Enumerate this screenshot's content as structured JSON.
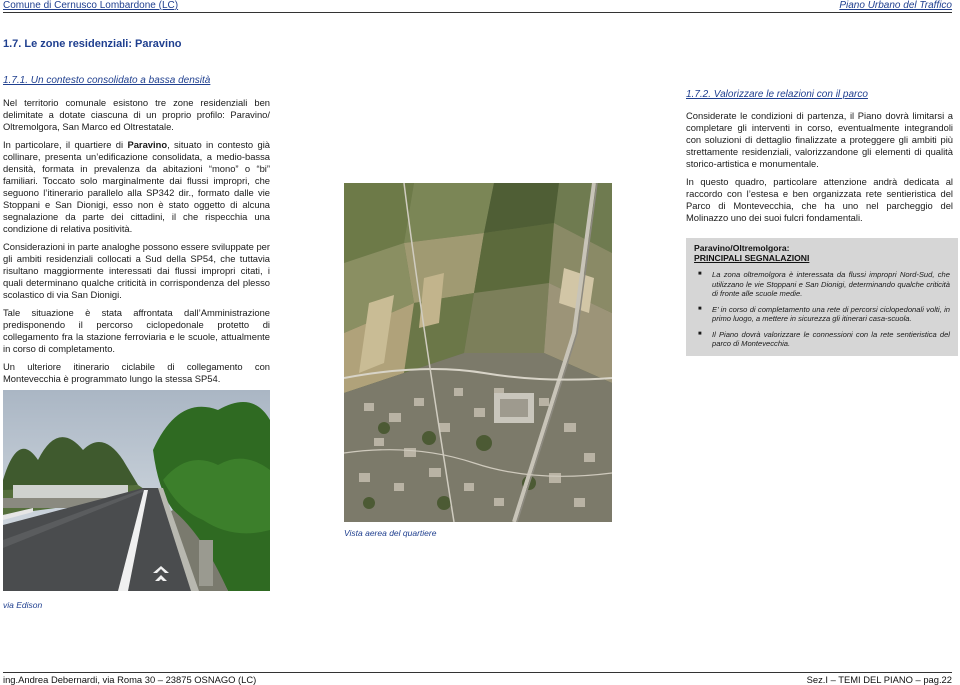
{
  "header": {
    "left": "Comune di Cernusco Lombardone (LC)",
    "right": "Piano Urbano del Traffico"
  },
  "section_title": "1.7. Le zone residenziali: Paravino",
  "left_column": {
    "subtitle": "1.7.1. Un contesto consolidato a bassa densità",
    "p1": "Nel territorio comunale esistono tre zone residenziali ben delimitate a dotate ciascuna di un proprio profilo: Paravino/ Oltremolgora, San Marco ed Oltrestatale.",
    "p2_before": "In particolare, il quartiere di ",
    "p2_bold": "Paravino",
    "p2_after": ", situato in contesto già collinare, presenta un’edificazione consolidata, a medio-bassa densità, formata in prevalenza da abitazioni “mono” o “bi” familiari. Toccato solo marginalmente dai flussi impropri, che seguono l’itinerario parallelo alla SP342 dir., formato dalle vie Stoppani e San Dionigi, esso non è stato oggetto di alcuna segnalazione da parte dei cittadini, il che rispecchia una condizione di relativa positività.",
    "p3": "Considerazioni in parte analoghe possono essere sviluppate per gli ambiti residenziali collocati a Sud della SP54, che tuttavia risultano maggiormente interessati dai flussi impropri citati, i quali determinano qualche criticità in corrispondenza del plesso scolastico di via San Dionigi.",
    "p4": "Tale situazione è stata affrontata dall’Amministrazione predisponendo il percorso ciclopedonale protetto di collegamento fra la stazione ferroviaria e le scuole, attualmente in corso di completamento.",
    "p5": "Un ulteriore itinerario ciclabile di collegamento con Montevecchia è programmato lungo la stessa SP54."
  },
  "right_column": {
    "subtitle": "1.7.2. Valorizzare le relazioni con il parco",
    "p1": "Considerate le condizioni di partenza, il Piano dovrà limitarsi a completare gli interventi in corso, eventualmente integrandoli con soluzioni di dettaglio finalizzate a proteggere gli ambiti più strettamente residenziali, valorizzandone gli elementi di qualità storico-artistica e monumentale.",
    "p2": "In questo quadro, particolare attenzione andrà dedicata al raccordo con l’estesa e ben organizzata rete sentieristica del Parco di Montevecchia, che ha uno nel parcheggio del Molinazzo uno dei suoi fulcri fondamentali."
  },
  "box": {
    "title": "Paravino/Oltremolgora:",
    "subtitle": "PRINCIPALI SEGNALAZIONI",
    "bullet_symbol": "■",
    "items": [
      "La zona oltremolgora è interessata da flussi impropri Nord-Sud, che utilizzano le vie Stoppani e San Dionigi, determinando qualche criticità di fronte alle scuole medie.",
      "E’ in corso di completamento una rete di percorsi ciclopedonali volti, in primo luogo, a mettere in sicurezza gli itinerari casa-scuola.",
      "Il Piano dovrà valorizzare le connessioni con la rete sentieristica del parco di Montevecchia."
    ]
  },
  "captions": {
    "aerial": "Vista aerea del quartiere",
    "street": "via Edison"
  },
  "footer": {
    "left": "ing.Andrea Debernardi, via Roma 30 – 23875 OSNAGO (LC)",
    "right": "Sez.I – TEMI DEL PIANO – pag.22"
  },
  "colors": {
    "accent": "#1f3f8f",
    "box_background": "#d6d6d6"
  }
}
